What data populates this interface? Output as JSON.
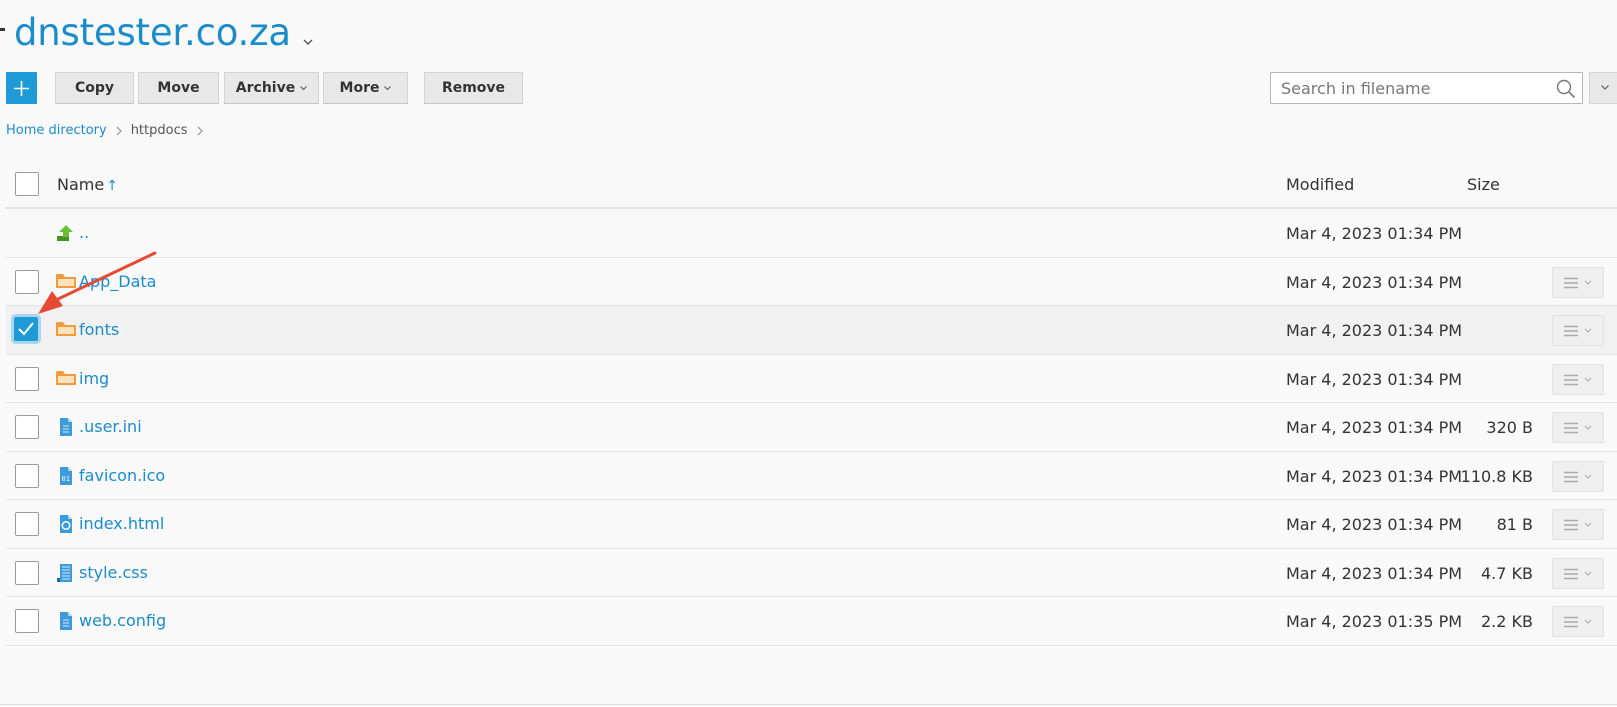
{
  "header": {
    "title": "dnstester.co.za"
  },
  "toolbar": {
    "add_icon": "plus-icon",
    "copy_label": "Copy",
    "move_label": "Move",
    "archive_label": "Archive",
    "more_label": "More",
    "remove_label": "Remove",
    "search_placeholder": "Search in filename"
  },
  "breadcrumb": {
    "items": [
      "Home directory",
      "httpdocs"
    ]
  },
  "table": {
    "columns": {
      "name": "Name",
      "sort_indicator": "↑",
      "modified": "Modified",
      "size": "Size"
    },
    "rows": [
      {
        "name": "..",
        "icon": "parent-directory-icon",
        "modified": "Mar 4, 2023 01:34 PM",
        "size": "",
        "checked": false
      },
      {
        "name": "App_Data",
        "icon": "folder-icon",
        "modified": "Mar 4, 2023 01:34 PM",
        "size": "",
        "checked": false
      },
      {
        "name": "fonts",
        "icon": "folder-icon",
        "modified": "Mar 4, 2023 01:34 PM",
        "size": "",
        "checked": true
      },
      {
        "name": "img",
        "icon": "folder-icon",
        "modified": "Mar 4, 2023 01:34 PM",
        "size": "",
        "checked": false
      },
      {
        "name": ".user.ini",
        "icon": "text-file-icon",
        "modified": "Mar 4, 2023 01:34 PM",
        "size": "320 B",
        "checked": false
      },
      {
        "name": "favicon.ico",
        "icon": "binary-file-icon",
        "modified": "Mar 4, 2023 01:34 PM",
        "size": "110.8 KB",
        "checked": false
      },
      {
        "name": "index.html",
        "icon": "html-file-icon",
        "modified": "Mar 4, 2023 01:34 PM",
        "size": "81 B",
        "checked": false
      },
      {
        "name": "style.css",
        "icon": "css-file-icon",
        "modified": "Mar 4, 2023 01:34 PM",
        "size": "4.7 KB",
        "checked": false
      },
      {
        "name": "web.config",
        "icon": "text-file-icon",
        "modified": "Mar 4, 2023 01:35 PM",
        "size": "2.2 KB",
        "checked": false
      }
    ]
  },
  "colors": {
    "accent": "#1a8ccb",
    "primary_button": "#1e9ad7",
    "folder": "#f7a04a",
    "parent_arrow": "#5aa92b",
    "annotation_arrow": "#e64a35"
  }
}
